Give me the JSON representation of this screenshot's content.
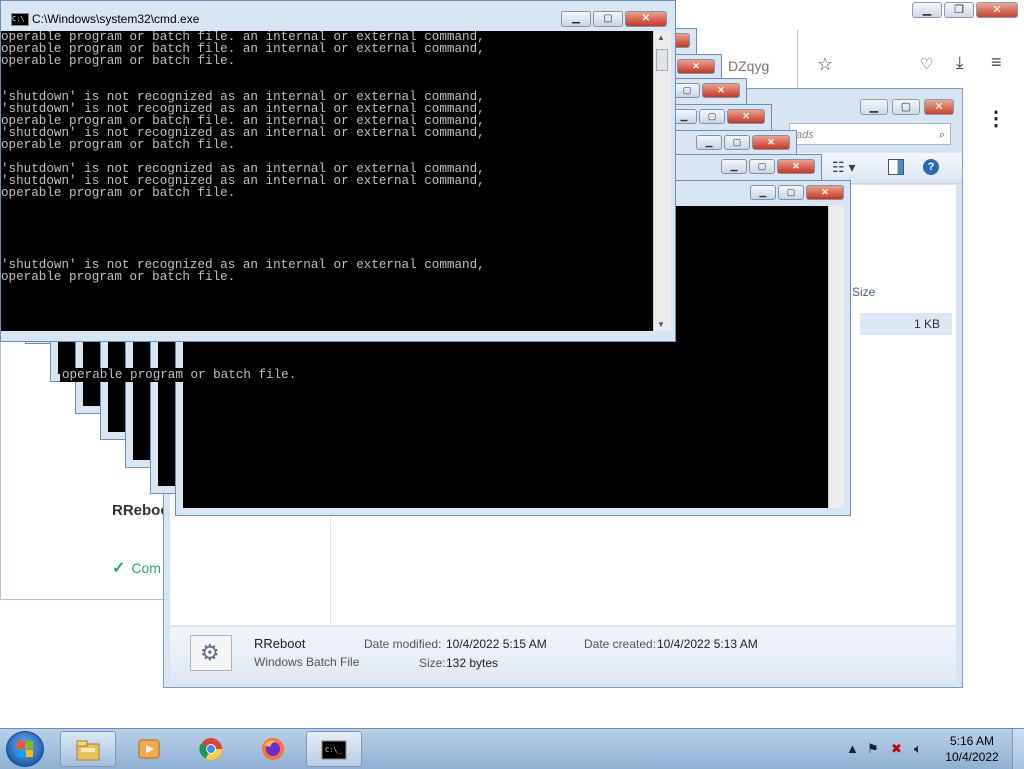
{
  "browser": {
    "address_tail": "DZqyg",
    "page_title": "RReboot",
    "status_text": "Com"
  },
  "explorer": {
    "search_placeholder": "ads",
    "column_size": "Size",
    "row_size": "1 KB",
    "details": {
      "name": "RReboot",
      "type": "Windows Batch File",
      "date_modified_label": "Date modified:",
      "date_modified": "10/4/2022 5:15 AM",
      "date_created_label": "Date created:",
      "date_created": "10/4/2022 5:13 AM",
      "size_label": "Size:",
      "size": "132 bytes"
    }
  },
  "cmd": {
    "title": "C:\\Windows\\system32\\cmd.exe",
    "lines": [
      "operable program or batch file. an internal or external command,",
      "operable program or batch file. an internal or external command,",
      "operable program or batch file.",
      "",
      "",
      "'shutdown' is not recognized as an internal or external command,",
      "'shutdown' is not recognized as an internal or external command,",
      "operable program or batch file. an internal or external command,",
      "'shutdown' is not recognized as an internal or external command,",
      "operable program or batch file.",
      "",
      "'shutdown' is not recognized as an internal or external command,",
      "'shutdown' is not recognized as an internal or external command,",
      "operable program or batch file.",
      "",
      "",
      "",
      "",
      "",
      "'shutdown' is not recognized as an internal or external command,",
      "operable program or batch file."
    ],
    "stray_line": "operable program or batch file."
  },
  "taskbar": {
    "time": "5:16 AM",
    "date": "10/4/2022",
    "apps": [
      "explorer-icon",
      "media-player-icon",
      "chrome-icon",
      "firefox-icon",
      "cmd-icon"
    ]
  },
  "colors": {
    "console_bg": "#000000",
    "console_fg": "#c0c0c0",
    "accent_green": "#2ca37d",
    "taskbar": "#9fbddd"
  }
}
